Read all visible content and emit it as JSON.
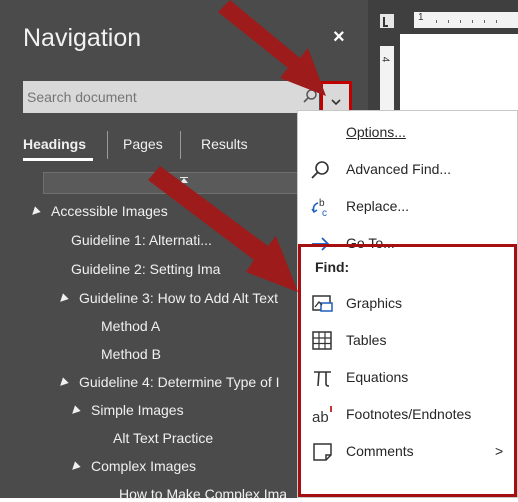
{
  "nav": {
    "title": "Navigation",
    "close": "×",
    "search_placeholder": "Search document",
    "tabs": [
      "Headings",
      "Pages",
      "Results"
    ],
    "headings": [
      {
        "label": "Accessible Images",
        "level": 1,
        "expanded": true
      },
      {
        "label": "Guideline 1: Alternati...",
        "level": 2
      },
      {
        "label": "Guideline 2: Setting Ima",
        "level": 2
      },
      {
        "label": "Guideline 3: How to Add Alt Text",
        "level": 2,
        "expanded": true
      },
      {
        "label": "Method A",
        "level": 3
      },
      {
        "label": "Method B",
        "level": 3
      },
      {
        "label": "Guideline 4: Determine Type of I",
        "level": 2,
        "expanded": true
      },
      {
        "label": "Simple Images",
        "level": 3,
        "expanded": true
      },
      {
        "label": "Alt Text Practice",
        "level": 4
      },
      {
        "label": "Complex Images",
        "level": 3,
        "expanded": true
      },
      {
        "label": "How to Make Complex Ima",
        "level": 4
      }
    ]
  },
  "ruler": {
    "top_number": "1",
    "left_number": "4"
  },
  "menu": {
    "options": "Options...",
    "advanced_find": "Advanced Find...",
    "replace": "Replace...",
    "goto": "Go To...",
    "find_header": "Find:",
    "graphics": "Graphics",
    "tables": "Tables",
    "equations": "Equations",
    "footnotes": "Footnotes/Endnotes",
    "comments": "Comments",
    "submenu_arrow": ">"
  },
  "colors": {
    "pane_bg": "#4b4b4b",
    "highlight_red": "#a50f0f",
    "arrow_red": "#9e1b1b"
  }
}
